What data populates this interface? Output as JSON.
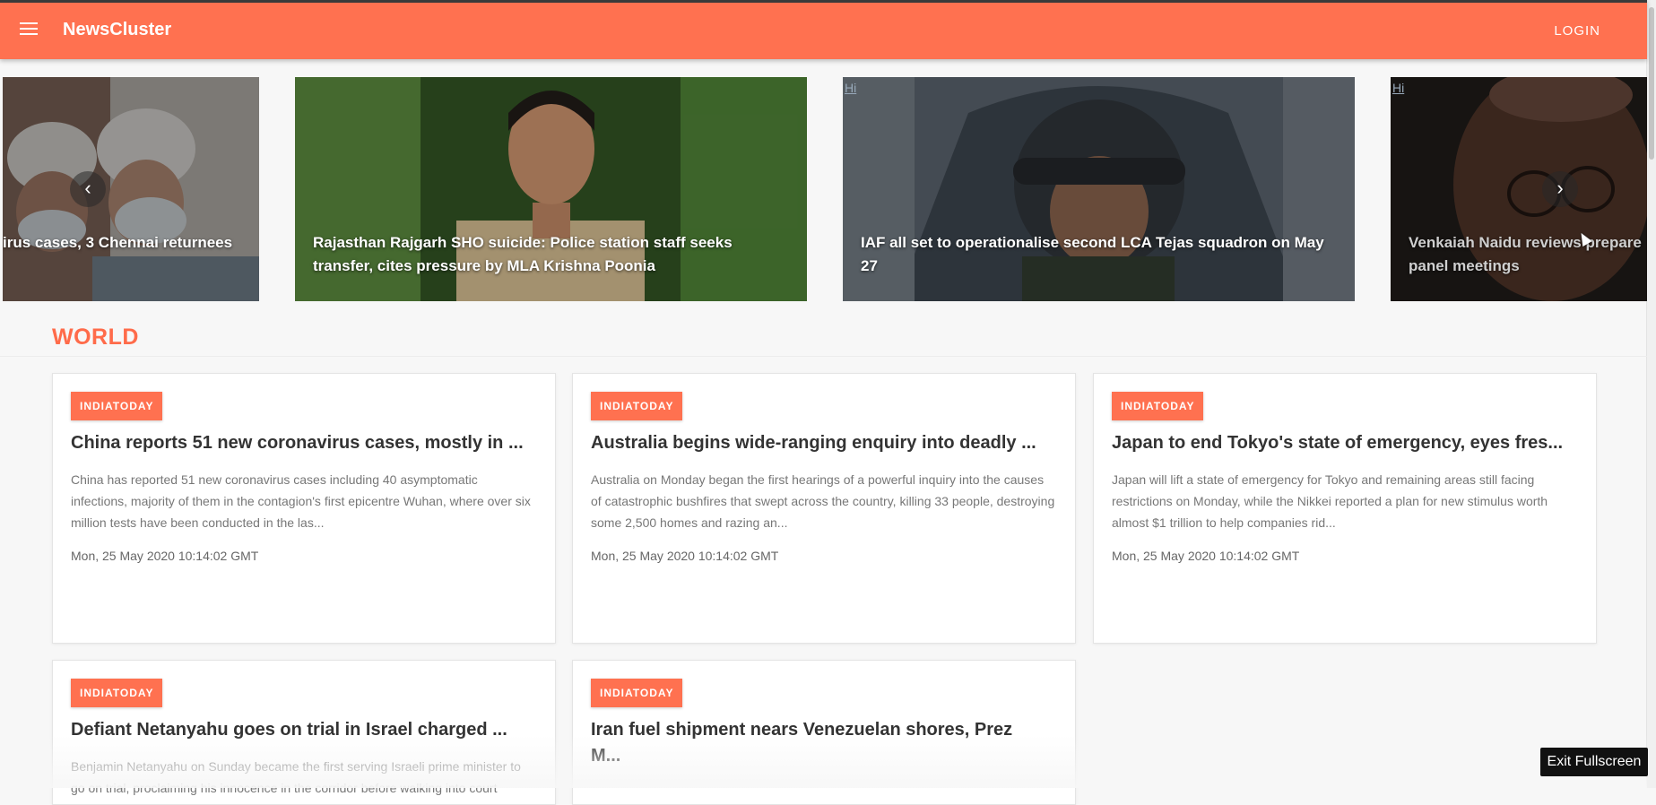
{
  "app": {
    "title": "NewsCluster",
    "login_label": "LOGIN",
    "menu_icon": "menu-icon"
  },
  "carousel": {
    "prev_glyph": "‹",
    "next_glyph": "›",
    "slides": [
      {
        "caption": "irus cases, 3 Chennai returnees",
        "hi": ""
      },
      {
        "caption": "Rajasthan Rajgarh SHO suicide: Police station staff seeks transfer, cites pressure by MLA Krishna Poonia",
        "hi": ""
      },
      {
        "caption": "IAF all set to operationalise second LCA Tejas squadron on May 27",
        "hi": "Hi"
      },
      {
        "caption": "Venkaiah Naidu reviews prepare panel meetings",
        "hi": "Hi"
      }
    ]
  },
  "section": {
    "title": "WORLD"
  },
  "articles": [
    {
      "source": "INDIATODAY",
      "title": "China reports 51 new coronavirus cases, mostly in ...",
      "summary": "China has reported 51 new coronavirus cases including 40 asymptomatic infections, majority of them in the contagion's first epicentre Wuhan, where over six million tests have been conducted in the las...",
      "date": "Mon, 25 May 2020 10:14:02 GMT"
    },
    {
      "source": "INDIATODAY",
      "title": "Australia begins wide-ranging enquiry into deadly ...",
      "summary": "Australia on Monday began the first hearings of a powerful inquiry into the causes of catastrophic bushfires that swept across the country, killing 33 people, destroying some 2,500 homes and razing an...",
      "date": "Mon, 25 May 2020 10:14:02 GMT"
    },
    {
      "source": "INDIATODAY",
      "title": "Japan to end Tokyo's state of emergency, eyes fres...",
      "summary": "Japan will lift a state of emergency for Tokyo and remaining areas still facing restrictions on Monday, while the Nikkei reported a plan for new stimulus worth almost $1 trillion to help companies rid...",
      "date": "Mon, 25 May 2020 10:14:02 GMT"
    },
    {
      "source": "INDIATODAY",
      "title": "Defiant Netanyahu goes on trial in Israel charged ...",
      "summary": "Benjamin Netanyahu on Sunday became the first serving Israeli prime minister to go on trial, proclaiming his innocence in the corridor before walking into court",
      "date": ""
    },
    {
      "source": "INDIATODAY",
      "title": "Iran fuel shipment nears Venezuelan shores, Prez M...",
      "summary": "",
      "date": ""
    }
  ],
  "overlay": {
    "exit_fullscreen_label": "Exit Fullscreen"
  },
  "colors": {
    "accent": "#ff7150",
    "section_title": "#ff6b4a"
  }
}
